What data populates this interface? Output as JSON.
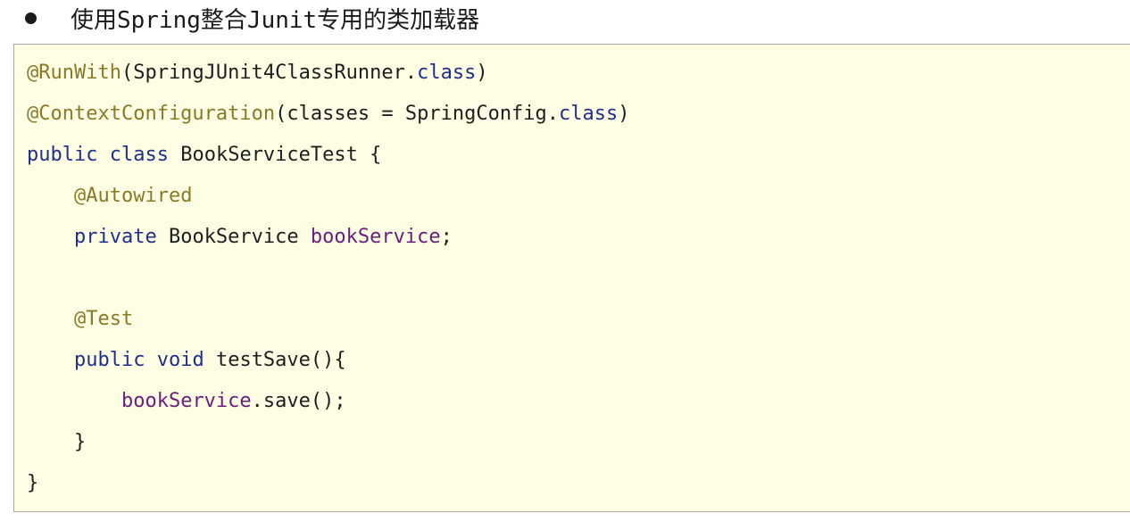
{
  "heading": {
    "text": "使用Spring整合Junit专用的类加载器",
    "icon": "bullet-dot-icon"
  },
  "colors": {
    "background": "#fefee4",
    "border": "#a8a8a8",
    "annotation": "#8a7a26",
    "keyword": "#1f2f8a",
    "field": "#6a1d7a",
    "text": "#1e1e1e"
  },
  "code": {
    "line1": {
      "ann": "@RunWith",
      "open": "(SpringJUnit4ClassRunner.",
      "kw": "class",
      "close": ")"
    },
    "line2": {
      "ann": "@ContextConfiguration",
      "open": "(classes = SpringConfig.",
      "kw": "class",
      "close": ")"
    },
    "line3": {
      "kw1": "public",
      "kw2": "class",
      "rest": "BookServiceTest {"
    },
    "line4": {
      "ann": "@Autowired"
    },
    "line5": {
      "kw": "private",
      "type": "BookService",
      "field": "bookService",
      "end": ";"
    },
    "line7": {
      "ann": "@Test"
    },
    "line8": {
      "kw1": "public",
      "kw2": "void",
      "rest": "testSave(){"
    },
    "line9": {
      "field": "bookService",
      "rest": ".save();"
    },
    "line10": {
      "text": "}"
    },
    "line11": {
      "text": "}"
    }
  }
}
